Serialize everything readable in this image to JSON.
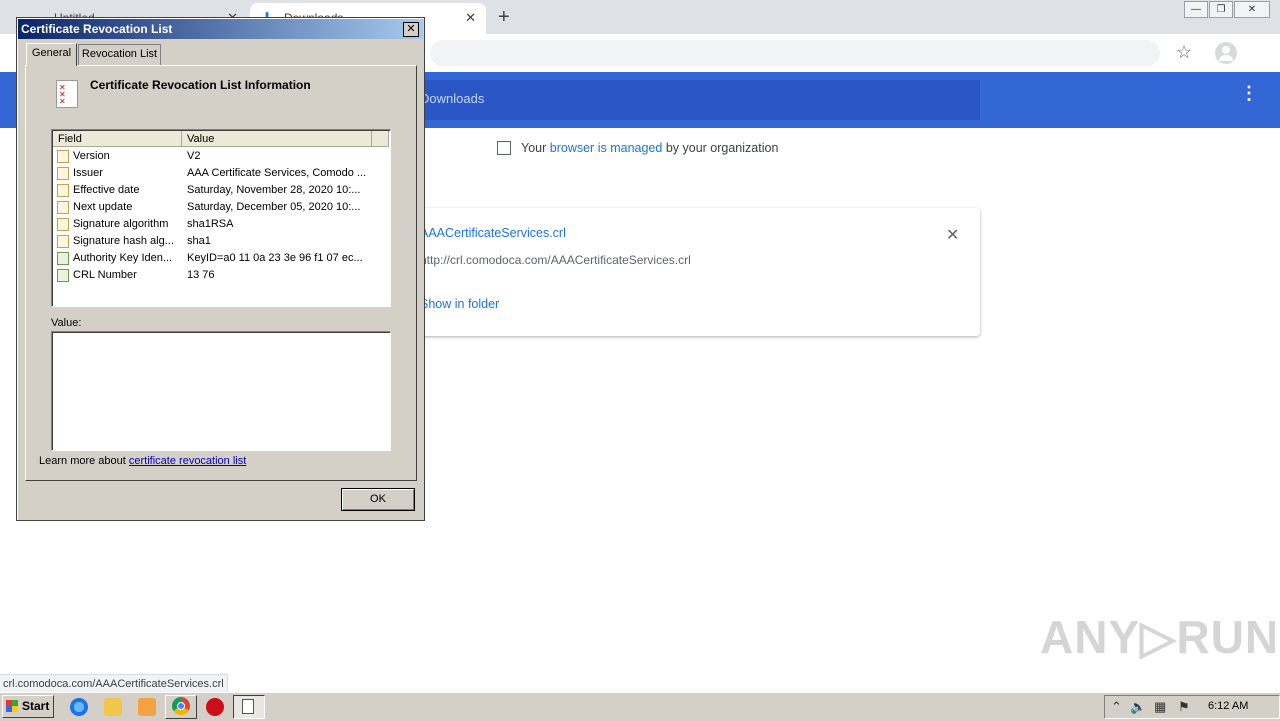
{
  "browser": {
    "tabs": [
      {
        "label": "Untitled"
      },
      {
        "label": "Downloads"
      }
    ],
    "new_tab_symbol": "+",
    "window_controls": {
      "minimize": "—",
      "restore": "❐",
      "close": "✕"
    },
    "star_icon": "☆",
    "menu_icon": "•••"
  },
  "downloads": {
    "title": "Downloads",
    "managed": {
      "prefix": "Your",
      "link1": "browser",
      "middle": "is",
      "link2": "managed",
      "suffix": "by your organization"
    },
    "card": {
      "file_name": "AAACertificateServices.crl",
      "url": "http://crl.comodoca.com/AAACertificateServices.crl",
      "show_in_folder": "Show in folder",
      "close_symbol": "✕"
    },
    "status_url": "crl.comodoca.com/AAACertificateServices.crl"
  },
  "dialog": {
    "title": "Certificate Revocation List",
    "close_symbol": "✕",
    "tabs": {
      "general": "General",
      "revocation": "Revocation List"
    },
    "info_title": "Certificate Revocation List Information",
    "columns": {
      "field": "Field",
      "value": "Value"
    },
    "rows": [
      {
        "field": "Version",
        "value": "V2"
      },
      {
        "field": "Issuer",
        "value": "AAA Certificate Services, Comodo ..."
      },
      {
        "field": "Effective date",
        "value": "Saturday, November 28, 2020 10:..."
      },
      {
        "field": "Next update",
        "value": "Saturday, December 05, 2020 10:..."
      },
      {
        "field": "Signature algorithm",
        "value": "sha1RSA"
      },
      {
        "field": "Signature hash alg...",
        "value": "sha1"
      },
      {
        "field": "Authority Key Iden...",
        "value": "KeyID=a0 11 0a 23 3e 96 f1 07 ec..."
      },
      {
        "field": "CRL Number",
        "value": "13 76"
      }
    ],
    "value_label": "Value:",
    "learn_prefix": "Learn more about",
    "learn_link": "certificate revocation list",
    "ok": "OK"
  },
  "taskbar": {
    "start": "Start",
    "clock": "6:12 AM"
  },
  "watermark": "ANY▷RUN"
}
